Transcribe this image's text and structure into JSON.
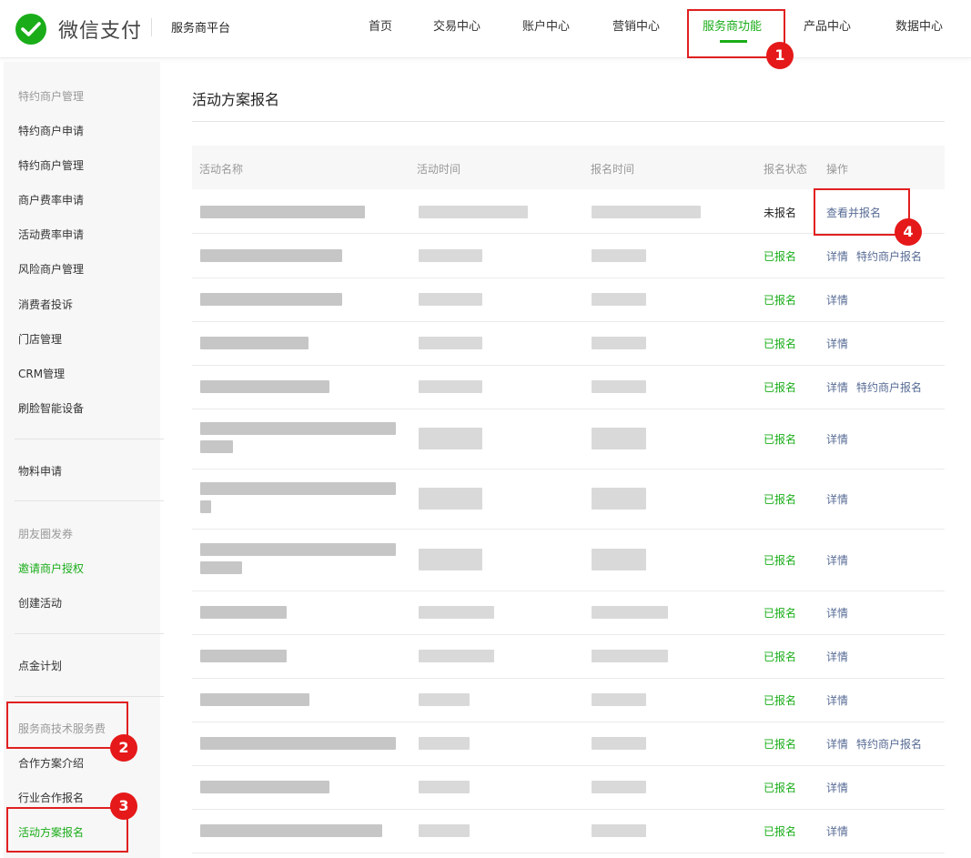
{
  "header": {
    "brand": "微信支付",
    "platform": "服务商平台",
    "nav": [
      "首页",
      "交易中心",
      "账户中心",
      "营销中心",
      "服务商功能",
      "产品中心",
      "数据中心"
    ],
    "active_nav": "服务商功能"
  },
  "sidebar": {
    "items": [
      "特约商户管理",
      "特约商户申请",
      "特约商户管理",
      "商户费率申请",
      "活动费率申请",
      "风险商户管理",
      "消费者投诉",
      "门店管理",
      "CRM管理",
      "刷脸智能设备",
      "物料申请",
      "朋友圈发券",
      "邀请商户授权",
      "创建活动",
      "点金计划",
      "服务商技术服务费",
      "合作方案介绍",
      "行业合作报名",
      "活动方案报名"
    ]
  },
  "main": {
    "title": "活动方案报名",
    "columns": [
      "活动名称",
      "活动时间",
      "报名时间",
      "报名状态",
      "操作"
    ],
    "rows": [
      {
        "status": "未报名",
        "ops": [
          "查看并报名"
        ]
      },
      {
        "status": "已报名",
        "ops": [
          "详情",
          "特约商户报名"
        ]
      },
      {
        "status": "已报名",
        "ops": [
          "详情"
        ]
      },
      {
        "status": "已报名",
        "ops": [
          "详情"
        ]
      },
      {
        "status": "已报名",
        "ops": [
          "详情",
          "特约商户报名"
        ]
      },
      {
        "status": "已报名",
        "ops": [
          "详情"
        ]
      },
      {
        "status": "已报名",
        "ops": [
          "详情"
        ]
      },
      {
        "status": "已报名",
        "ops": [
          "详情"
        ]
      },
      {
        "status": "已报名",
        "ops": [
          "详情"
        ]
      },
      {
        "status": "已报名",
        "ops": [
          "详情"
        ]
      },
      {
        "status": "已报名",
        "ops": [
          "详情"
        ]
      },
      {
        "status": "已报名",
        "ops": [
          "详情",
          "特约商户报名"
        ]
      },
      {
        "status": "已报名",
        "ops": [
          "详情"
        ]
      },
      {
        "status": "已报名",
        "ops": [
          "详情"
        ]
      }
    ]
  },
  "annotations": [
    "1",
    "2",
    "3",
    "4"
  ],
  "colors": {
    "brand_green": "#1aad19",
    "link_blue": "#576b95",
    "marker_red": "#e51919"
  }
}
